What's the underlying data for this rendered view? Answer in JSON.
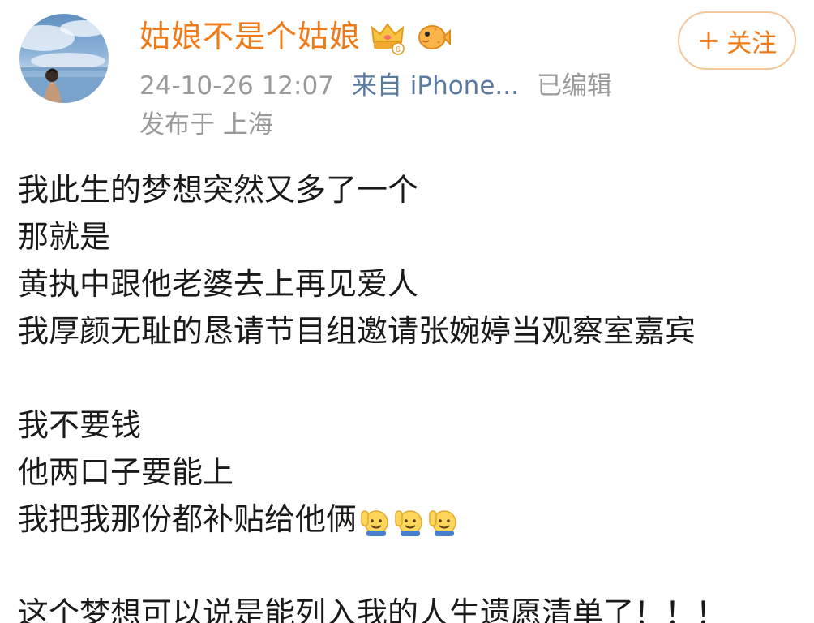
{
  "header": {
    "username": "姑娘不是个姑娘",
    "follow_label": "关注",
    "follow_plus": "+",
    "timestamp": "24-10-26 12:07",
    "source": "来自 iPhone...",
    "edited": "已编辑",
    "location": "发布于 上海",
    "badge_level": "6",
    "username_color": "#f27a16"
  },
  "post": {
    "lines": [
      "我此生的梦想突然又多了一个",
      "那就是",
      "黄执中跟他老婆去上再见爱人",
      "我厚颜无耻的恳请节目组邀请张婉婷当观察室嘉宾",
      "",
      "我不要钱",
      "他两口子要能上",
      "我把我那份都补贴给他俩",
      "",
      "这个梦想可以说是能列入我的人生遗愿清单了！！！"
    ],
    "emoji_after_line_8": [
      "raised-hand-smile-icon",
      "raised-hand-smile-icon",
      "raised-hand-smile-icon"
    ]
  }
}
